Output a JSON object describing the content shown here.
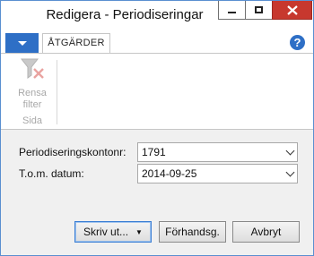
{
  "window": {
    "title": "Redigera - Periodiseringar"
  },
  "ribbon": {
    "tab_label": "ÅTGÄRDER",
    "rensa_filter_line1": "Rensa",
    "rensa_filter_line2": "filter",
    "group_label": "Sida",
    "help_glyph": "?"
  },
  "form": {
    "konton_label": "Periodiseringskontonr:",
    "konton_value": "1791",
    "datum_label": "T.o.m. datum:",
    "datum_value": "2014-09-25"
  },
  "buttons": {
    "print_label": "Skriv ut...",
    "preview_label": "Förhandsg.",
    "cancel_label": "Avbryt"
  },
  "colors": {
    "accent": "#2e6fc6",
    "close": "#c7382e"
  },
  "icons": [
    "minimize-icon",
    "maximize-icon",
    "close-icon",
    "help-icon",
    "clear-filter-icon",
    "chevron-down-icon"
  ]
}
